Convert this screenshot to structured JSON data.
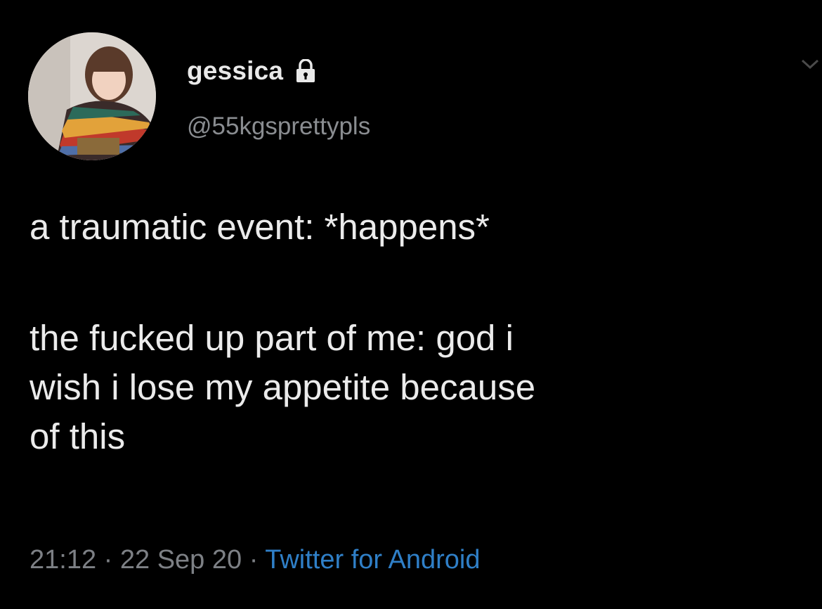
{
  "user": {
    "display_name": "gessica",
    "handle": "@55kgsprettypls",
    "avatar_icon": "profile-photo",
    "lock_icon": "lock-icon"
  },
  "tweet": {
    "lines": [
      "a traumatic event: *happens*",
      "the fucked up part of me: god i",
      "wish i lose my appetite because",
      "of this"
    ]
  },
  "meta": {
    "time": "21:12",
    "separator": "·",
    "date": "22 Sep 20",
    "source": "Twitter for Android"
  },
  "colors": {
    "background": "#000000",
    "text": "#ebebeb",
    "secondary": "#7d8085",
    "link": "#2f7fc7"
  }
}
